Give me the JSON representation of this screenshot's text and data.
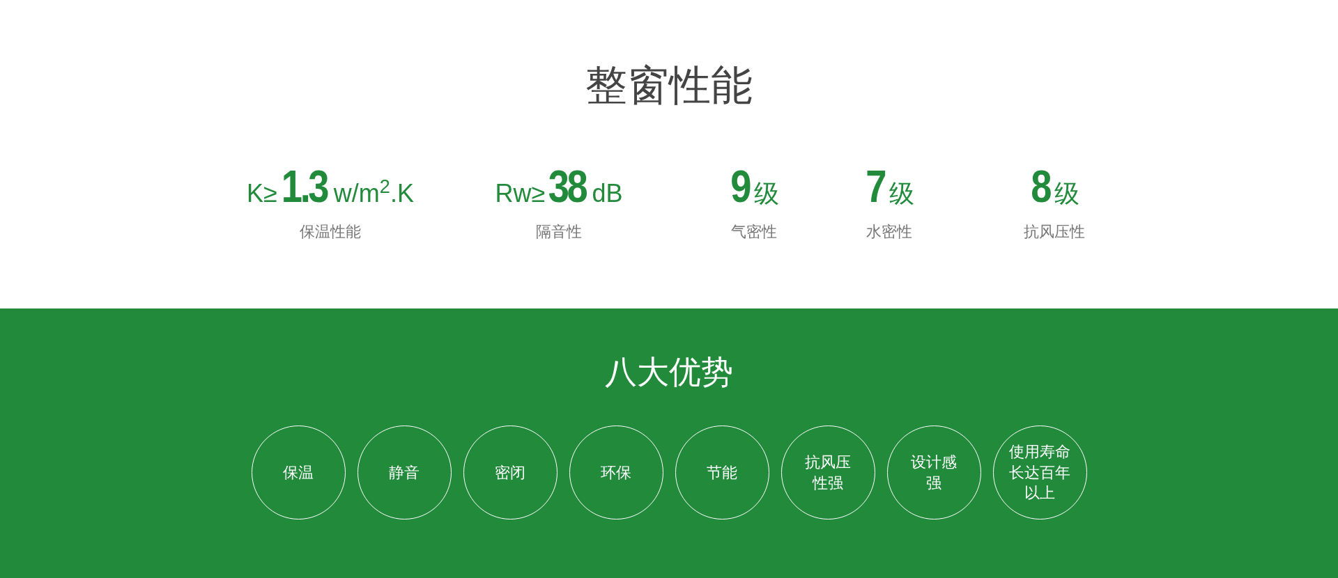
{
  "performance": {
    "title": "整窗性能",
    "metrics": [
      {
        "prefix": "K≥",
        "value": "1.3",
        "unit": "w/m$^{2}$.K",
        "label": "保温性能"
      },
      {
        "prefix": "Rw≥",
        "value": "38",
        "unit": "dB",
        "label": "隔音性"
      },
      {
        "value": "9",
        "unit": "级",
        "label": "气密性"
      },
      {
        "value": "7",
        "unit": "级",
        "label": "水密性"
      },
      {
        "value": "8",
        "unit": "级",
        "label": "抗风压性"
      }
    ]
  },
  "advantages": {
    "title": "八大优势",
    "items": [
      {
        "lines": [
          "保温"
        ]
      },
      {
        "lines": [
          "静音"
        ]
      },
      {
        "lines": [
          "密闭"
        ]
      },
      {
        "lines": [
          "环保"
        ]
      },
      {
        "lines": [
          "节能"
        ]
      },
      {
        "lines": [
          "抗风压",
          "性强"
        ]
      },
      {
        "lines": [
          "设计感",
          "强"
        ]
      },
      {
        "lines": [
          "使用寿命",
          "长达百年",
          "以上"
        ]
      }
    ]
  }
}
